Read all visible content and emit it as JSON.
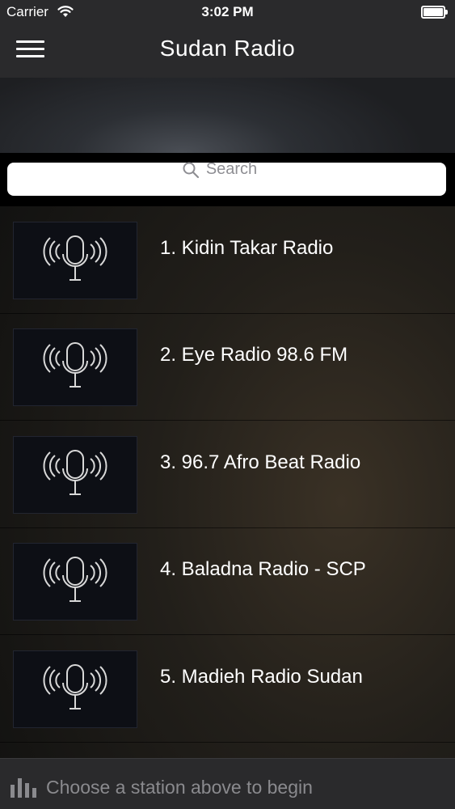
{
  "status_bar": {
    "carrier": "Carrier",
    "time": "3:02 PM",
    "battery_level": 1.0
  },
  "nav": {
    "title": "Sudan Radio",
    "menu_icon": "hamburger-menu-icon"
  },
  "search": {
    "placeholder": "Search",
    "icon": "search-icon"
  },
  "stations": [
    {
      "label": "1. Kidin Takar Radio",
      "icon": "microphone-broadcast-icon"
    },
    {
      "label": "2. Eye Radio 98.6 FM",
      "icon": "microphone-broadcast-icon"
    },
    {
      "label": "3. 96.7 Afro Beat Radio",
      "icon": "microphone-broadcast-icon"
    },
    {
      "label": "4. Baladna Radio - SCP",
      "icon": "microphone-broadcast-icon"
    },
    {
      "label": "5. Madieh Radio Sudan",
      "icon": "microphone-broadcast-icon"
    }
  ],
  "player": {
    "message": "Choose a station above to begin",
    "icon": "equalizer-bars-icon"
  },
  "colors": {
    "bar_background": "#2a2a2c",
    "text": "#ffffff",
    "muted_text": "#8a8a8e"
  }
}
